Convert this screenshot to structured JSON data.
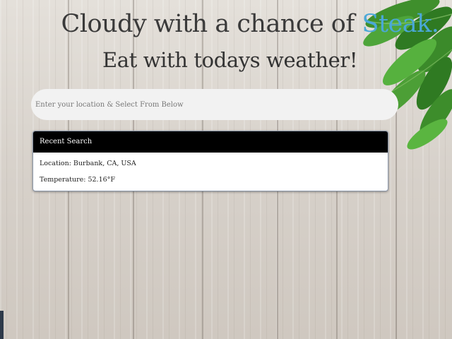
{
  "header": {
    "title_prefix": "Cloudy with a chance of ",
    "title_accent": "Steak.",
    "subtitle": "Eat with todays weather!"
  },
  "search": {
    "placeholder": "Enter your location & Select From Below"
  },
  "recent": {
    "heading": "Recent Search",
    "location": "Location: Burbank, CA, USA",
    "temperature": "Temperature: 52.16°F"
  },
  "colors": {
    "accent": "#4aa8d8",
    "card_header": "#000000",
    "heading_text": "#3a3a3a"
  },
  "icons": {
    "decoration": "basil-leaves-icon"
  }
}
